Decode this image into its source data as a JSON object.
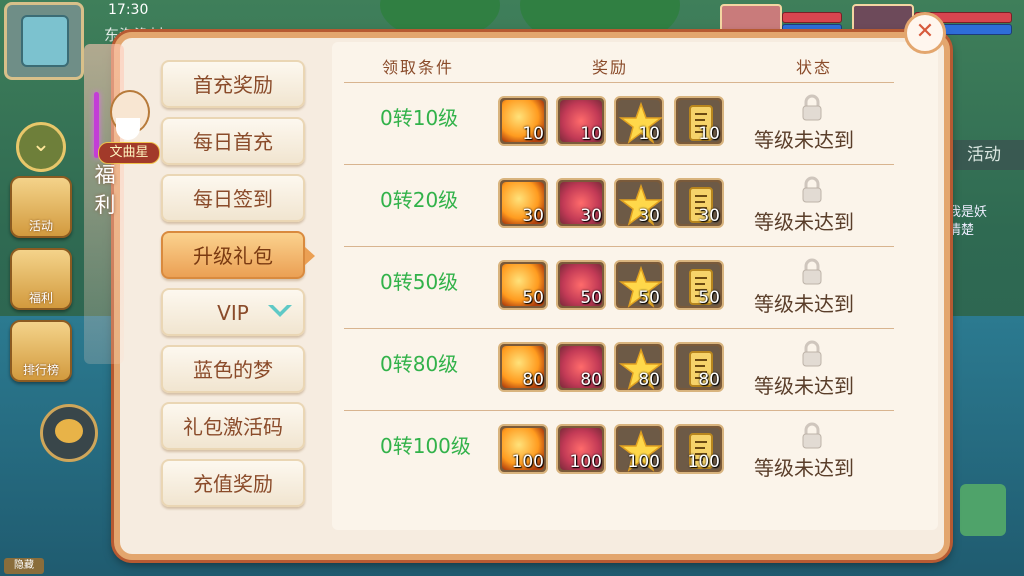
{
  "topbar": {
    "time": "17:30",
    "location": "东海渔村"
  },
  "side": {
    "activity_label": "活动",
    "fuli_label": "福利",
    "rank_label": "排行榜",
    "right_tab": "活动",
    "right_text_line1": "我是妖",
    "right_text_line2": "情楚",
    "bottom_tag": "隐藏"
  },
  "panel": {
    "npc_name": "文曲星",
    "category_label": "福利",
    "menu": [
      {
        "label": "首充奖励",
        "active": false
      },
      {
        "label": "每日首充",
        "active": false
      },
      {
        "label": "每日签到",
        "active": false
      },
      {
        "label": "升级礼包",
        "active": true
      },
      {
        "label": "VIP",
        "active": false
      },
      {
        "label": "蓝色的梦",
        "active": false
      },
      {
        "label": "礼包激活码",
        "active": false
      },
      {
        "label": "充值奖励",
        "active": false
      }
    ],
    "headers": {
      "condition": "领取条件",
      "reward": "奖励",
      "status": "状态"
    },
    "rows": [
      {
        "condition": "0转10级",
        "counts": [
          "10",
          "10",
          "10",
          "10"
        ],
        "status": "等级未达到"
      },
      {
        "condition": "0转20级",
        "counts": [
          "30",
          "30",
          "30",
          "30"
        ],
        "status": "等级未达到"
      },
      {
        "condition": "0转50级",
        "counts": [
          "50",
          "50",
          "50",
          "50"
        ],
        "status": "等级未达到"
      },
      {
        "condition": "0转80级",
        "counts": [
          "80",
          "80",
          "80",
          "80"
        ],
        "status": "等级未达到"
      },
      {
        "condition": "0转100级",
        "counts": [
          "100",
          "100",
          "100",
          "100"
        ],
        "status": "等级未达到"
      }
    ],
    "reward_icons": [
      "fire-orb-icon",
      "red-feather-icon",
      "gold-star-icon",
      "gold-scroll-icon"
    ]
  },
  "colors": {
    "condition_green": "#32b24a",
    "panel_border": "#e3a66e",
    "active_tab": "#eba054"
  }
}
